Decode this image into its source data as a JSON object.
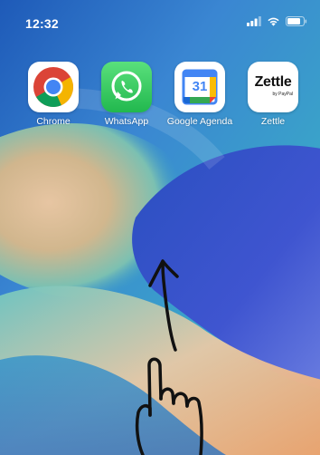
{
  "status_bar": {
    "time": "12:32",
    "icons": [
      "cellular-signal-icon",
      "wifi-icon",
      "battery-icon"
    ]
  },
  "apps": [
    {
      "label": "Chrome",
      "icon": "chrome-icon"
    },
    {
      "label": "WhatsApp",
      "icon": "whatsapp-icon"
    },
    {
      "label": "Google Agenda",
      "icon": "google-calendar-icon",
      "icon_text": "31"
    },
    {
      "label": "Zettle",
      "icon": "zettle-icon",
      "icon_text": "Zettle",
      "icon_subtext": "by PayPal"
    }
  ],
  "annotation": {
    "gesture": "swipe-up",
    "icons": [
      "hand-drawn-up-arrow-icon",
      "hand-pointer-icon"
    ]
  },
  "colors": {
    "chrome_red": "#db4437",
    "chrome_yellow": "#f4b400",
    "chrome_green": "#0f9d58",
    "chrome_blue": "#4285f4",
    "whatsapp_green": "#2fd15d",
    "calendar_blue": "#4285f4",
    "wallpaper_blue": "#2d6cc8"
  }
}
